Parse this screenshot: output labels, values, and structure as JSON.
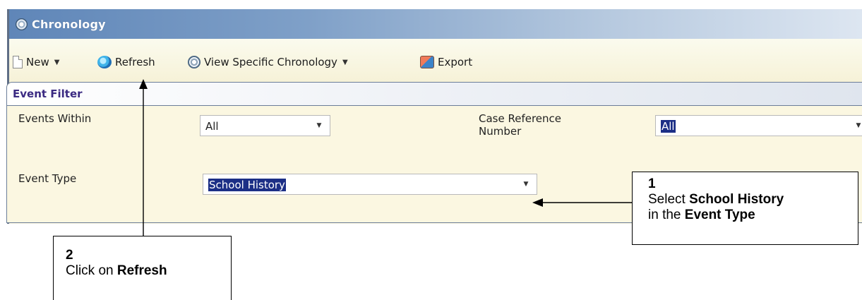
{
  "window": {
    "title": "Chronology"
  },
  "toolbar": {
    "new_label": "New",
    "refresh_label": "Refresh",
    "view_label": "View Specific Chronology",
    "export_label": "Export"
  },
  "filter": {
    "header": "Event Filter",
    "events_within_label": "Events Within",
    "events_within_value": "All",
    "case_ref_label_line1": "Case Reference",
    "case_ref_label_line2": "Number",
    "case_ref_value": "All",
    "event_type_label": "Event Type",
    "event_type_value": "School History"
  },
  "callouts": {
    "c1": {
      "number": "1",
      "pre1": "Select ",
      "bold1": "School History",
      "pre2": "in the ",
      "bold2": "Event Type"
    },
    "c2": {
      "number": "2",
      "pre1": "Click on ",
      "bold1": "Refresh"
    }
  },
  "icons": {
    "window": "chronology-icon",
    "new": "new-document-icon",
    "refresh": "refresh-icon",
    "view": "chronology-view-icon",
    "export": "export-icon"
  },
  "colors": {
    "title_gradient_start": "#5f86b8",
    "panel_background": "#fbf7e1",
    "filter_header_text": "#3b2a82",
    "selection": "#1c2f86"
  }
}
